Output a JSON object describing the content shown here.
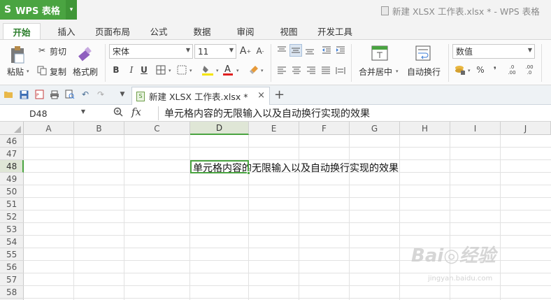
{
  "app": {
    "logo": "S",
    "name": "WPS 表格",
    "dropdown": "▾"
  },
  "window_title": "新建 XLSX 工作表.xlsx * - WPS 表格",
  "tabs": [
    {
      "label": "开始",
      "active": true
    },
    {
      "label": "插入"
    },
    {
      "label": "页面布局"
    },
    {
      "label": "公式"
    },
    {
      "label": "数据"
    },
    {
      "label": "审阅"
    },
    {
      "label": "视图"
    },
    {
      "label": "开发工具"
    }
  ],
  "ribbon": {
    "paste": "粘贴",
    "cut": "剪切",
    "copy": "复制",
    "format_painter": "格式刷",
    "font_name": "宋体",
    "font_size": "11",
    "bold": "B",
    "italic": "I",
    "underline": "U",
    "merge_center": "合并居中",
    "wrap_text": "自动换行",
    "number_format": "数值",
    "percent": "%",
    "comma": "❜",
    "inc_decimal": ".0 .00",
    "dec_decimal": ".00 .0"
  },
  "document_tab": {
    "label": "新建 XLSX 工作表.xlsx *",
    "close": "×",
    "new_tab": "+"
  },
  "formula_bar": {
    "name_box": "D48",
    "fx": "fx",
    "content": "单元格内容的无限输入以及自动换行实现的效果"
  },
  "columns": [
    "A",
    "B",
    "C",
    "D",
    "E",
    "F",
    "G",
    "H",
    "I",
    "J"
  ],
  "rows": [
    "46",
    "47",
    "48",
    "49",
    "50",
    "51",
    "52",
    "53",
    "54",
    "55",
    "56",
    "57",
    "58"
  ],
  "selected_column": "D",
  "selected_row": "48",
  "cell_d48": "单元格内容的无限输入以及自动换行实现的效果",
  "watermark": {
    "text": "Bai◎经验",
    "url": "jingyan.baidu.com"
  },
  "colors": {
    "accent": "#4aa441",
    "selection": "#dfe6d6"
  }
}
